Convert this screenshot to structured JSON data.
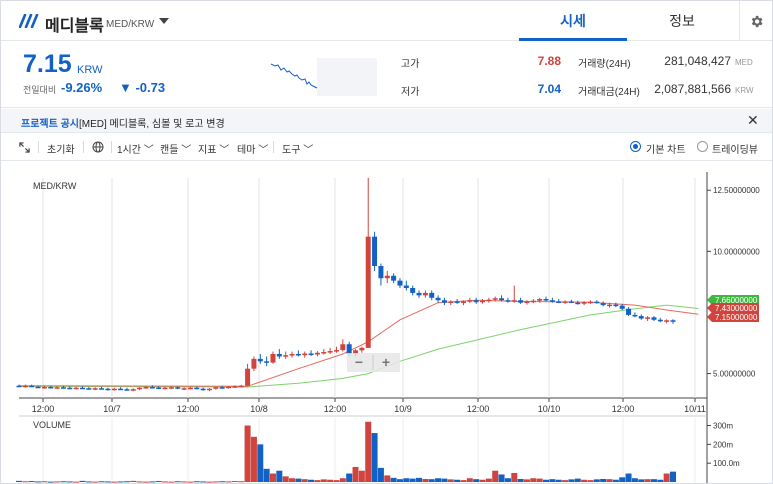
{
  "header": {
    "coin_name": "메디블록",
    "pair": "MED/KRW",
    "tabs": [
      {
        "label": "시세",
        "active": true
      },
      {
        "label": "정보",
        "active": false
      }
    ]
  },
  "summary": {
    "price": "7.15",
    "price_currency": "KRW",
    "change_label": "전일대비",
    "change_percent": "-9.26%",
    "change_amount": "▼ -0.73",
    "high_label": "고가",
    "high_value": "7.88",
    "low_label": "저가",
    "low_value": "7.04",
    "volume_label": "거래량(24H)",
    "volume_value": "281,048,427",
    "volume_unit": "MED",
    "turnover_label": "거래대금(24H)",
    "turnover_value": "2,087,881,566",
    "turnover_unit": "KRW"
  },
  "notice": {
    "tag": "프로젝트 공시",
    "text": "[MED] 메디블록, 심볼 및 로고 변경"
  },
  "toolbar": {
    "reset": "초기화",
    "interval": "1시간",
    "candle": "캔들",
    "indicator": "지표",
    "theme": "테마",
    "tools": "도구",
    "basic_chart": "기본 차트",
    "tradingview": "트레이딩뷰"
  },
  "colors": {
    "up": "#d0443d",
    "down": "#1261c4",
    "ma_short": "#e8685f",
    "ma_long": "#7dd36b"
  },
  "chart_data": {
    "type": "candlestick",
    "title": "MED/KRW",
    "volume_title": "VOLUME",
    "x_ticks": [
      "12:00",
      "10/7",
      "12:00",
      "10/8",
      "12:00",
      "10/9",
      "12:00",
      "10/10",
      "12:00",
      "10/11"
    ],
    "y_ticks": [
      "12.50000000",
      "10.00000000",
      "5.00000000"
    ],
    "ylim": [
      4.0,
      13.0
    ],
    "volume_ticks": [
      "300m",
      "200m",
      "100.0m"
    ],
    "volume_ylim": [
      0,
      340
    ],
    "price_labels": [
      {
        "value": "7.66000000",
        "color": "#3fb83f"
      },
      {
        "value": "7.43000000",
        "color": "#d0443d"
      },
      {
        "value": "7.15000000",
        "color": "#d0443d"
      }
    ],
    "zoom_out": "−",
    "zoom_in": "+",
    "candles": [
      [
        4.5,
        4.55,
        4.45,
        4.48
      ],
      [
        4.48,
        4.55,
        4.42,
        4.5
      ],
      [
        4.5,
        4.55,
        4.45,
        4.46
      ],
      [
        4.46,
        4.5,
        4.4,
        4.44
      ],
      [
        4.44,
        4.5,
        4.38,
        4.45
      ],
      [
        4.45,
        4.5,
        4.4,
        4.43
      ],
      [
        4.43,
        4.48,
        4.38,
        4.44
      ],
      [
        4.44,
        4.5,
        4.4,
        4.42
      ],
      [
        4.42,
        4.48,
        4.36,
        4.4
      ],
      [
        4.4,
        4.46,
        4.35,
        4.42
      ],
      [
        4.42,
        4.48,
        4.38,
        4.4
      ],
      [
        4.4,
        4.45,
        4.34,
        4.38
      ],
      [
        4.38,
        4.44,
        4.32,
        4.4
      ],
      [
        4.4,
        4.46,
        4.36,
        4.38
      ],
      [
        4.38,
        4.42,
        4.3,
        4.35
      ],
      [
        4.35,
        4.42,
        4.3,
        4.38
      ],
      [
        4.38,
        4.44,
        4.34,
        4.36
      ],
      [
        4.36,
        4.42,
        4.3,
        4.34
      ],
      [
        4.34,
        4.4,
        4.28,
        4.36
      ],
      [
        4.36,
        4.44,
        4.32,
        4.42
      ],
      [
        4.42,
        4.5,
        4.38,
        4.45
      ],
      [
        4.45,
        4.52,
        4.4,
        4.43
      ],
      [
        4.43,
        4.48,
        4.36,
        4.4
      ],
      [
        4.4,
        4.46,
        4.35,
        4.42
      ],
      [
        4.42,
        4.48,
        4.38,
        4.44
      ],
      [
        4.44,
        4.48,
        4.36,
        4.38
      ],
      [
        4.38,
        4.44,
        4.32,
        4.4
      ],
      [
        4.4,
        4.46,
        4.35,
        4.42
      ],
      [
        4.42,
        4.46,
        4.36,
        4.38
      ],
      [
        4.38,
        4.42,
        4.3,
        4.34
      ],
      [
        4.34,
        4.4,
        4.28,
        4.38
      ],
      [
        4.38,
        4.46,
        4.34,
        4.44
      ],
      [
        4.44,
        4.5,
        4.4,
        4.42
      ],
      [
        4.42,
        4.48,
        4.38,
        4.46
      ],
      [
        4.46,
        4.52,
        4.42,
        4.48
      ],
      [
        4.48,
        4.54,
        4.44,
        4.5
      ],
      [
        4.5,
        5.4,
        4.48,
        5.2
      ],
      [
        5.2,
        5.7,
        5.1,
        5.6
      ],
      [
        5.6,
        5.8,
        5.4,
        5.5
      ],
      [
        5.5,
        5.7,
        5.3,
        5.45
      ],
      [
        5.45,
        5.9,
        5.4,
        5.8
      ],
      [
        5.8,
        6.0,
        5.6,
        5.7
      ],
      [
        5.7,
        5.9,
        5.6,
        5.75
      ],
      [
        5.75,
        5.9,
        5.65,
        5.8
      ],
      [
        5.8,
        5.95,
        5.7,
        5.75
      ],
      [
        5.75,
        5.9,
        5.65,
        5.82
      ],
      [
        5.82,
        5.95,
        5.72,
        5.78
      ],
      [
        5.78,
        5.92,
        5.7,
        5.85
      ],
      [
        5.85,
        6.0,
        5.78,
        5.88
      ],
      [
        5.88,
        6.05,
        5.8,
        5.92
      ],
      [
        5.92,
        6.1,
        5.85,
        5.96
      ],
      [
        5.96,
        6.4,
        5.9,
        6.2
      ],
      [
        6.2,
        6.3,
        5.7,
        5.8
      ],
      [
        5.8,
        6.0,
        5.7,
        5.95
      ],
      [
        5.95,
        6.1,
        5.85,
        6.05
      ],
      [
        6.05,
        13.0,
        8.5,
        10.6
      ],
      [
        10.6,
        10.8,
        9.2,
        9.4
      ],
      [
        9.4,
        9.5,
        8.6,
        8.9
      ],
      [
        8.9,
        9.2,
        8.7,
        9.0
      ],
      [
        9.0,
        9.1,
        8.7,
        8.8
      ],
      [
        8.8,
        8.9,
        8.5,
        8.6
      ],
      [
        8.6,
        8.8,
        8.4,
        8.5
      ],
      [
        8.5,
        8.6,
        8.2,
        8.3
      ],
      [
        8.3,
        8.4,
        8.1,
        8.2
      ],
      [
        8.2,
        8.4,
        8.1,
        8.3
      ],
      [
        8.3,
        8.4,
        8.0,
        8.1
      ],
      [
        8.1,
        8.2,
        7.9,
        8.0
      ],
      [
        8.0,
        8.1,
        7.8,
        7.9
      ],
      [
        7.9,
        8.0,
        7.8,
        7.95
      ],
      [
        7.95,
        8.05,
        7.85,
        7.9
      ],
      [
        7.9,
        8.0,
        7.8,
        7.95
      ],
      [
        7.95,
        8.1,
        7.88,
        8.0
      ],
      [
        8.0,
        8.1,
        7.85,
        7.92
      ],
      [
        7.92,
        8.05,
        7.86,
        7.98
      ],
      [
        7.98,
        8.1,
        7.9,
        8.02
      ],
      [
        8.02,
        8.15,
        7.95,
        8.08
      ],
      [
        8.08,
        8.2,
        7.95,
        8.0
      ],
      [
        8.0,
        8.1,
        7.9,
        7.95
      ],
      [
        7.95,
        8.6,
        7.9,
        8.0
      ],
      [
        8.0,
        8.1,
        7.85,
        7.9
      ],
      [
        7.9,
        8.0,
        7.82,
        7.95
      ],
      [
        7.95,
        8.05,
        7.88,
        7.98
      ],
      [
        7.98,
        8.1,
        7.9,
        8.05
      ],
      [
        8.05,
        8.15,
        7.95,
        8.0
      ],
      [
        8.0,
        8.1,
        7.9,
        7.95
      ],
      [
        7.95,
        8.05,
        7.88,
        7.92
      ],
      [
        7.92,
        8.0,
        7.85,
        7.95
      ],
      [
        7.95,
        8.02,
        7.88,
        7.9
      ],
      [
        7.9,
        7.98,
        7.82,
        7.88
      ],
      [
        7.88,
        7.96,
        7.8,
        7.92
      ],
      [
        7.92,
        8.0,
        7.85,
        7.94
      ],
      [
        7.94,
        8.0,
        7.86,
        7.88
      ],
      [
        7.88,
        7.95,
        7.75,
        7.8
      ],
      [
        7.8,
        7.9,
        7.7,
        7.82
      ],
      [
        7.82,
        7.9,
        7.72,
        7.78
      ],
      [
        7.78,
        7.85,
        7.6,
        7.65
      ],
      [
        7.65,
        7.72,
        7.35,
        7.4
      ],
      [
        7.4,
        7.5,
        7.3,
        7.35
      ],
      [
        7.35,
        7.42,
        7.2,
        7.25
      ],
      [
        7.25,
        7.35,
        7.15,
        7.3
      ],
      [
        7.3,
        7.35,
        7.15,
        7.2
      ],
      [
        7.2,
        7.28,
        7.1,
        7.15
      ],
      [
        7.15,
        7.22,
        7.05,
        7.18
      ],
      [
        7.18,
        7.22,
        7.04,
        7.15
      ]
    ],
    "volume": [
      6,
      4,
      5,
      3,
      4,
      2,
      3,
      4,
      3,
      2,
      6,
      3,
      2,
      4,
      3,
      2,
      3,
      4,
      6,
      3,
      2,
      3,
      5,
      3,
      2,
      4,
      3,
      2,
      4,
      3,
      2,
      3,
      4,
      3,
      5,
      4,
      300,
      240,
      200,
      70,
      45,
      60,
      30,
      20,
      18,
      15,
      12,
      10,
      14,
      12,
      10,
      20,
      45,
      80,
      60,
      320,
      260,
      75,
      35,
      22,
      15,
      20,
      18,
      22,
      16,
      15,
      20,
      18,
      14,
      12,
      10,
      20,
      15,
      12,
      18,
      60,
      40,
      20,
      48,
      16,
      14,
      20,
      18,
      12,
      15,
      12,
      10,
      14,
      18,
      12,
      10,
      14,
      16,
      15,
      12,
      25,
      45,
      20,
      14,
      15,
      15,
      12,
      45,
      55
    ],
    "ma_short": [
      [
        0,
        4.5
      ],
      [
        36,
        4.48
      ],
      [
        44,
        5.2
      ],
      [
        51,
        5.8
      ],
      [
        55,
        6.3
      ],
      [
        60,
        7.2
      ],
      [
        66,
        7.9
      ],
      [
        72,
        8.0
      ],
      [
        79,
        7.95
      ],
      [
        90,
        7.92
      ],
      [
        97,
        7.8
      ],
      [
        102,
        7.6
      ],
      [
        107,
        7.43
      ]
    ],
    "ma_long": [
      [
        0,
        4.48
      ],
      [
        36,
        4.45
      ],
      [
        44,
        4.6
      ],
      [
        51,
        4.8
      ],
      [
        55,
        5.0
      ],
      [
        60,
        5.5
      ],
      [
        66,
        6.0
      ],
      [
        79,
        6.8
      ],
      [
        90,
        7.4
      ],
      [
        97,
        7.65
      ],
      [
        102,
        7.8
      ],
      [
        107,
        7.66
      ]
    ]
  }
}
